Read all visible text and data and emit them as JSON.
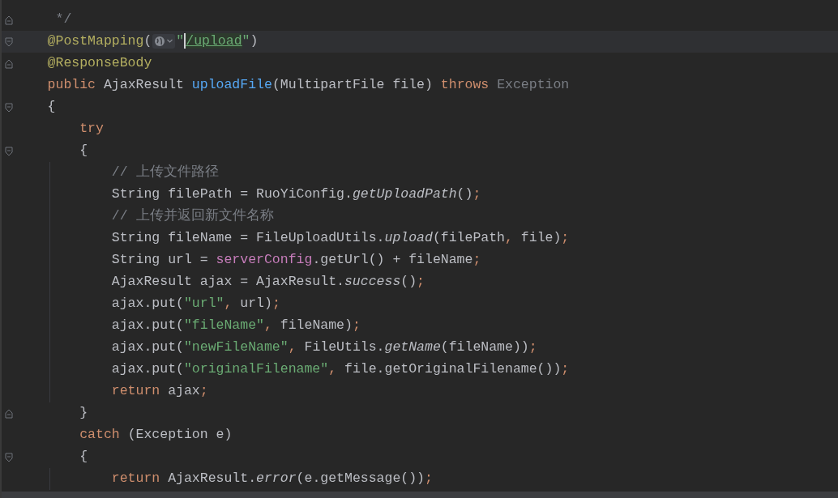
{
  "editor": {
    "lines": [
      {
        "kind": "closer",
        "tokens": [
          {
            "kind": "comment",
            "text": "     */"
          }
        ]
      },
      {
        "kind": "opener",
        "current": true,
        "tokens": [
          {
            "kind": "annotation",
            "text": "    @PostMapping"
          },
          {
            "kind": "plain",
            "text": "("
          },
          {
            "kind": "inlay"
          },
          {
            "kind": "string",
            "text": "\""
          },
          {
            "kind": "url",
            "text": "/upload",
            "caret": true
          },
          {
            "kind": "string",
            "text": "\""
          },
          {
            "kind": "plain",
            "text": ")"
          }
        ]
      },
      {
        "kind": "closer",
        "tokens": [
          {
            "kind": "annotation",
            "text": "    @ResponseBody"
          }
        ]
      },
      {
        "kind": "code",
        "tokens": [
          {
            "kind": "keyword",
            "text": "    public"
          },
          {
            "kind": "plain",
            "text": " AjaxResult "
          },
          {
            "kind": "method",
            "text": "uploadFile"
          },
          {
            "kind": "plain",
            "text": "(MultipartFile file) "
          },
          {
            "kind": "keyword",
            "text": "throws"
          },
          {
            "kind": "muted",
            "text": " Exception"
          }
        ]
      },
      {
        "kind": "opener",
        "tokens": [
          {
            "kind": "plain",
            "text": "    {"
          }
        ]
      },
      {
        "kind": "code",
        "tokens": [
          {
            "kind": "keyword",
            "text": "        try"
          }
        ]
      },
      {
        "kind": "opener",
        "tokens": [
          {
            "kind": "plain",
            "text": "        {"
          }
        ]
      },
      {
        "kind": "code",
        "tokens": [
          {
            "kind": "comment",
            "text": "            // 上传文件路径"
          }
        ]
      },
      {
        "kind": "code",
        "tokens": [
          {
            "kind": "plain",
            "text": "            String filePath = RuoYiConfig."
          },
          {
            "kind": "static",
            "text": "getUploadPath"
          },
          {
            "kind": "plain",
            "text": "()"
          },
          {
            "kind": "punct",
            "text": ";"
          }
        ]
      },
      {
        "kind": "code",
        "tokens": [
          {
            "kind": "comment",
            "text": "            // 上传并返回新文件名称"
          }
        ]
      },
      {
        "kind": "code",
        "tokens": [
          {
            "kind": "plain",
            "text": "            String fileName = FileUploadUtils."
          },
          {
            "kind": "static",
            "text": "upload"
          },
          {
            "kind": "plain",
            "text": "(filePath"
          },
          {
            "kind": "punct",
            "text": ","
          },
          {
            "kind": "plain",
            "text": " file)"
          },
          {
            "kind": "punct",
            "text": ";"
          }
        ]
      },
      {
        "kind": "code",
        "tokens": [
          {
            "kind": "plain",
            "text": "            String url = "
          },
          {
            "kind": "field",
            "text": "serverConfig"
          },
          {
            "kind": "plain",
            "text": ".getUrl() + fileName"
          },
          {
            "kind": "punct",
            "text": ";"
          }
        ]
      },
      {
        "kind": "code",
        "tokens": [
          {
            "kind": "plain",
            "text": "            AjaxResult ajax = AjaxResult."
          },
          {
            "kind": "static",
            "text": "success"
          },
          {
            "kind": "plain",
            "text": "()"
          },
          {
            "kind": "punct",
            "text": ";"
          }
        ]
      },
      {
        "kind": "code",
        "tokens": [
          {
            "kind": "plain",
            "text": "            ajax.put("
          },
          {
            "kind": "string",
            "text": "\"url\""
          },
          {
            "kind": "punct",
            "text": ","
          },
          {
            "kind": "plain",
            "text": " url)"
          },
          {
            "kind": "punct",
            "text": ";"
          }
        ]
      },
      {
        "kind": "code",
        "tokens": [
          {
            "kind": "plain",
            "text": "            ajax.put("
          },
          {
            "kind": "string",
            "text": "\"fileName\""
          },
          {
            "kind": "punct",
            "text": ","
          },
          {
            "kind": "plain",
            "text": " fileName)"
          },
          {
            "kind": "punct",
            "text": ";"
          }
        ]
      },
      {
        "kind": "code",
        "tokens": [
          {
            "kind": "plain",
            "text": "            ajax.put("
          },
          {
            "kind": "string",
            "text": "\"newFileName\""
          },
          {
            "kind": "punct",
            "text": ","
          },
          {
            "kind": "plain",
            "text": " FileUtils."
          },
          {
            "kind": "static",
            "text": "getName"
          },
          {
            "kind": "plain",
            "text": "(fileName))"
          },
          {
            "kind": "punct",
            "text": ";"
          }
        ]
      },
      {
        "kind": "code",
        "tokens": [
          {
            "kind": "plain",
            "text": "            ajax.put("
          },
          {
            "kind": "string",
            "text": "\"originalFilename\""
          },
          {
            "kind": "punct",
            "text": ","
          },
          {
            "kind": "plain",
            "text": " file.getOriginalFilename())"
          },
          {
            "kind": "punct",
            "text": ";"
          }
        ]
      },
      {
        "kind": "code",
        "tokens": [
          {
            "kind": "keyword",
            "text": "            return"
          },
          {
            "kind": "plain",
            "text": " ajax"
          },
          {
            "kind": "punct",
            "text": ";"
          }
        ]
      },
      {
        "kind": "closer",
        "tokens": [
          {
            "kind": "plain",
            "text": "        }"
          }
        ]
      },
      {
        "kind": "code",
        "tokens": [
          {
            "kind": "keyword",
            "text": "        catch"
          },
          {
            "kind": "plain",
            "text": " (Exception e)"
          }
        ]
      },
      {
        "kind": "opener",
        "tokens": [
          {
            "kind": "plain",
            "text": "        {"
          }
        ]
      },
      {
        "kind": "code",
        "tokens": [
          {
            "kind": "keyword",
            "text": "            return"
          },
          {
            "kind": "plain",
            "text": " AjaxResult."
          },
          {
            "kind": "static",
            "text": "error"
          },
          {
            "kind": "plain",
            "text": "(e.getMessage())"
          },
          {
            "kind": "punct",
            "text": ";"
          }
        ]
      }
    ]
  }
}
